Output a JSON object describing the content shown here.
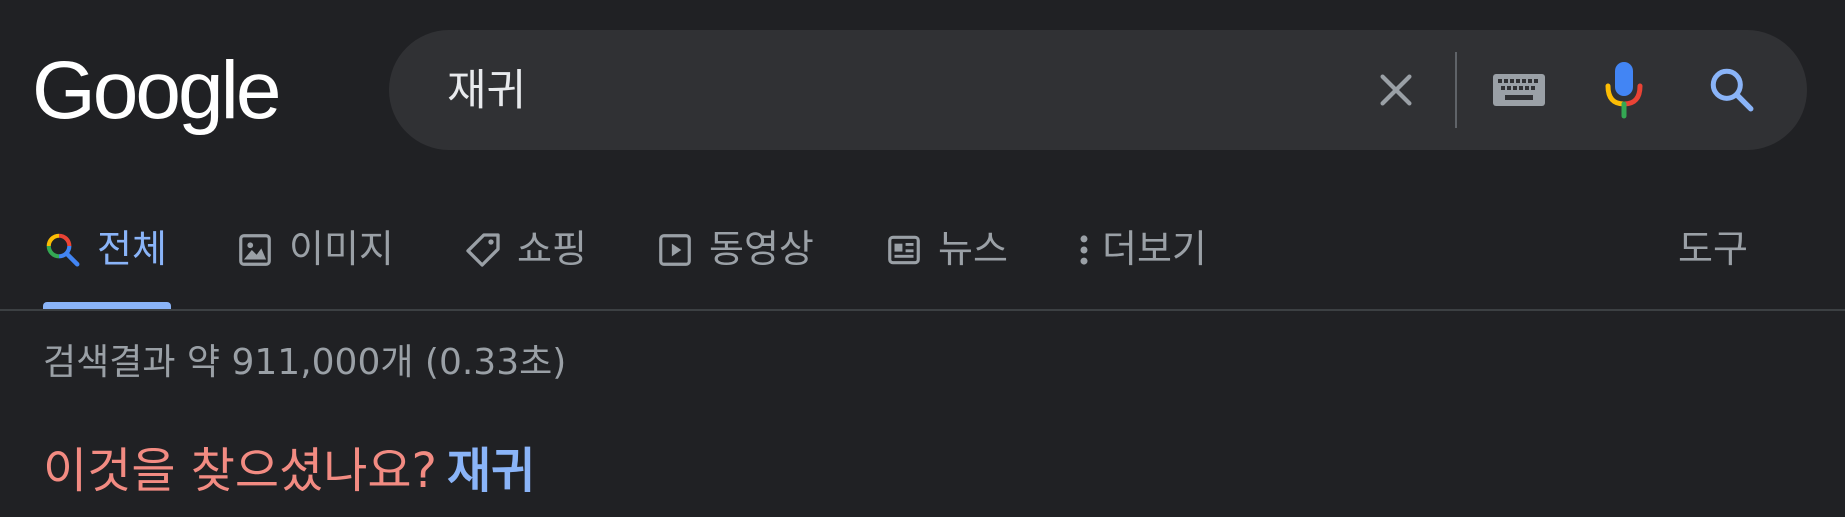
{
  "header": {
    "logo_text": "Google",
    "search": {
      "value": "재귀"
    }
  },
  "icons": {
    "clear": "close-icon",
    "keyboard": "keyboard-icon",
    "voice": "microphone-icon",
    "search": "search-icon"
  },
  "tabs": [
    {
      "label": "전체",
      "icon": "search-icon",
      "active": true
    },
    {
      "label": "이미지",
      "icon": "image-icon"
    },
    {
      "label": "쇼핑",
      "icon": "tag-icon"
    },
    {
      "label": "동영상",
      "icon": "play-icon"
    },
    {
      "label": "뉴스",
      "icon": "news-icon"
    },
    {
      "label": "더보기",
      "icon": "more-vert-icon"
    }
  ],
  "tools_label": "도구",
  "results": {
    "stats": "검색결과 약 911,000개 (0.33초)"
  },
  "did_you_mean": {
    "prompt": "이것을 찾으셨나요?",
    "suggestion": "재귀"
  },
  "colors": {
    "background": "#202124",
    "searchbox": "#303134",
    "accent": "#8ab4f8",
    "prompt": "#f28b82",
    "muted": "#9aa0a6"
  }
}
